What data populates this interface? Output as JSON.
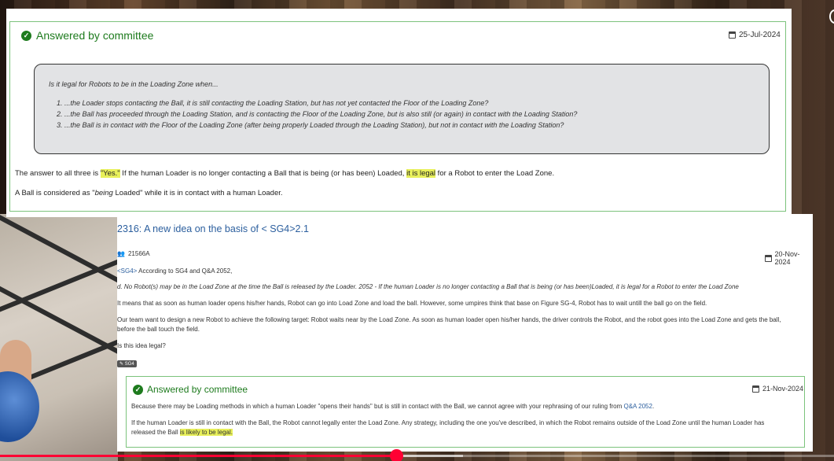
{
  "panel1": {
    "status": "Answered by committee",
    "date": "25-Jul-2024",
    "question_intro": "Is it legal for Robots to be in the Loading Zone when...",
    "question_items": [
      "1. ...the Loader stops contacting the Ball, it is still contacting the Loading Station, but has not yet contacted the Floor of the Loading Zone?",
      "2. ...the Ball has proceeded through the Loading Station, and is contacting the Floor of the Loading Zone, but is also still (or again) in contact with the Loading Station?",
      "3. ...the Ball is in contact with the Floor of the Loading Zone (after being properly Loaded through the Loading Station), but not in contact with the Loading Station?"
    ],
    "answer_pre": "The answer to all three is ",
    "answer_yes": "\"Yes.\"",
    "answer_mid": " If the human Loader is no longer contacting a Ball that is being (or has been) Loaded, ",
    "answer_hl": "it is legal",
    "answer_post": " for a Robot to enter the Load Zone.",
    "ball_pre": "A Ball is considered as \"",
    "ball_em": "being",
    "ball_post": " Loaded\" while it is in contact with a human Loader."
  },
  "panel2": {
    "title": "2316: A new idea on the basis of < SG4>2.1",
    "user": "21566A",
    "date": "20-Nov-2024",
    "line1_link": "<SG4>",
    "line1_text": " According to SG4 and Q&A 2052,",
    "line2": "d. No Robot(s) may be in the Load Zone at the time the Ball is released by the Loader. 2052 - If the human Loader is no longer contacting a Ball that is being (or has been)Loaded, it is legal for a Robot to enter the Load Zone",
    "line3": "It means that as soon as human loader opens his/her hands, Robot can go into Load Zone and load the ball. However, some umpires think that base on Figure SG-4, Robot has to wait untill the ball go on the field.",
    "line4": "Our team want to design a new Robot to achieve the following target: Robot waits near by the Load Zone. As soon as human loader open his/her hands, the driver controls the Robot, and the robot goes into the Load Zone and gets the ball,",
    "line5": "before the ball touch the field.",
    "line6": "Is this idea legal?",
    "tag": "SG4",
    "answer": {
      "status": "Answered by committee",
      "date": "21-Nov-2024",
      "text1": "Because there may be Loading methods in which a human Loader \"opens their hands\" but is still in contact with the Ball, we cannot agree with your rephrasing of our ruling from ",
      "text1_link": "Q&A 2052",
      "text1_end": ".",
      "text2": "If the human Loader is still in contact with the Ball, the Robot cannot legally enter the Load Zone. Any strategy, including the one you've described, in which the Robot remains outside of the Load Zone until the human Loader has",
      "text3_pre": "released the Ball ",
      "text3_hl": "is likely to be legal."
    }
  },
  "video": {
    "progress": 0.475,
    "buffered": 0.555,
    "accent": "#ff0033"
  }
}
